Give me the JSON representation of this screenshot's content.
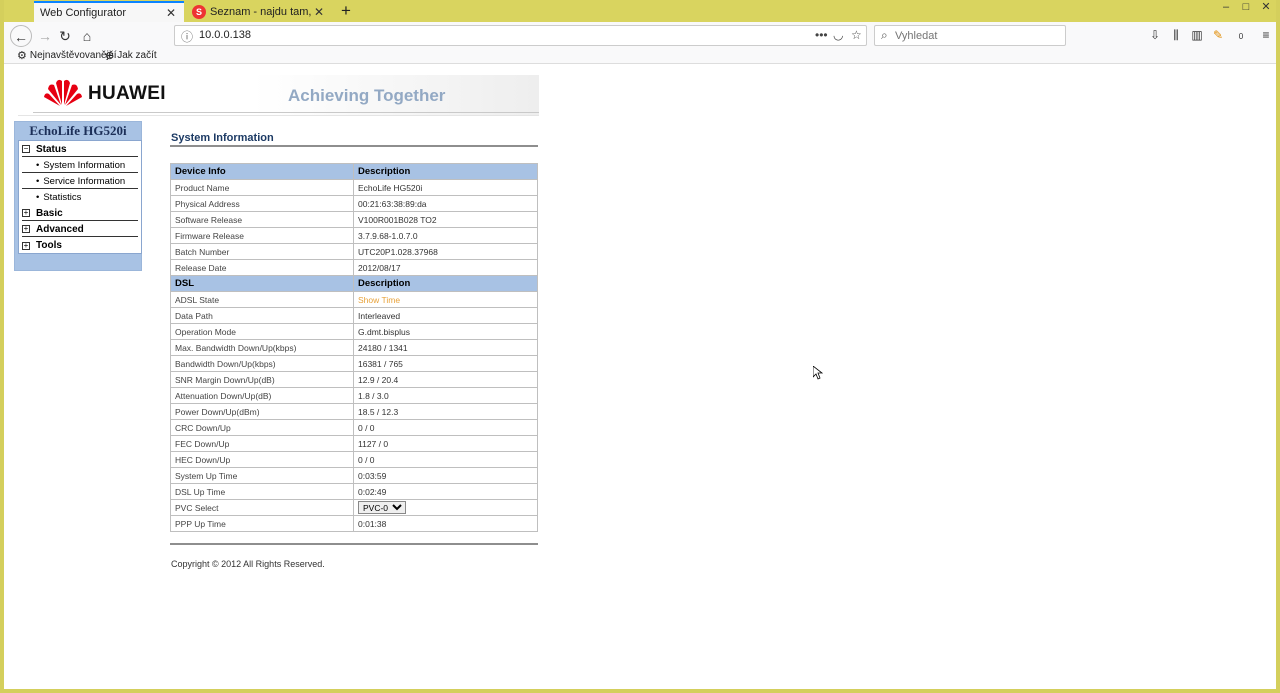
{
  "browser": {
    "tabs": [
      {
        "title": "Web Configurator",
        "active": true
      },
      {
        "title": "Seznam - najdu tam, co nezná…",
        "active": false
      }
    ],
    "url": "10.0.0.138",
    "search_placeholder": "Vyhledat",
    "page_actions_label": "•••",
    "bookmarks": [
      "Nejnavštěvovanější",
      "Jak začít"
    ],
    "notification_count": "0"
  },
  "banner": {
    "brand": "HUAWEI",
    "slogan": "Achieving Together"
  },
  "sidebar": {
    "device": "EchoLife HG520i",
    "groups": [
      {
        "label": "Status",
        "expanded": true,
        "items": [
          "System Information",
          "Service Information",
          "Statistics"
        ]
      },
      {
        "label": "Basic",
        "expanded": false
      },
      {
        "label": "Advanced",
        "expanded": false
      },
      {
        "label": "Tools",
        "expanded": false
      }
    ]
  },
  "main": {
    "title": "System Information",
    "device_header": [
      "Device Info",
      "Description"
    ],
    "device_rows": [
      [
        "Product Name",
        "EchoLife HG520i"
      ],
      [
        "Physical Address",
        "00:21:63:38:89:da"
      ],
      [
        "Software Release",
        "V100R001B028 TO2"
      ],
      [
        "Firmware Release",
        "3.7.9.68-1.0.7.0"
      ],
      [
        "Batch Number",
        "UTC20P1.028.37968"
      ],
      [
        "Release Date",
        "2012/08/17"
      ]
    ],
    "dsl_header": [
      "DSL",
      "Description"
    ],
    "dsl_rows": [
      [
        "ADSL State",
        "Show Time"
      ],
      [
        "Data Path",
        "Interleaved"
      ],
      [
        "Operation Mode",
        "G.dmt.bisplus"
      ],
      [
        "Max. Bandwidth Down/Up(kbps)",
        "24180 / 1341"
      ],
      [
        "Bandwidth Down/Up(kbps)",
        "16381 / 765"
      ],
      [
        "SNR Margin Down/Up(dB)",
        "12.9 / 20.4"
      ],
      [
        "Attenuation Down/Up(dB)",
        "1.8 / 3.0"
      ],
      [
        "Power Down/Up(dBm)",
        "18.5 / 12.3"
      ],
      [
        "CRC Down/Up",
        "0 / 0"
      ],
      [
        "FEC  Down/Up",
        "1127 / 0"
      ],
      [
        "HEC Down/Up",
        "0 / 0"
      ],
      [
        "System Up Time",
        "0:03:59"
      ],
      [
        "DSL Up Time",
        "0:02:49"
      ]
    ],
    "pvc_label": "PVC Select",
    "pvc_value": "PVC-0",
    "ppp_label": "PPP Up Time",
    "ppp_value": "0:01:38",
    "copyright": "Copyright © 2012 All Rights Reserved."
  },
  "colors": {
    "frame": "#d4cf5c",
    "table_header": "#a8c2e4",
    "status_orange": "#e8a23a",
    "section_title": "#1c3a64"
  }
}
